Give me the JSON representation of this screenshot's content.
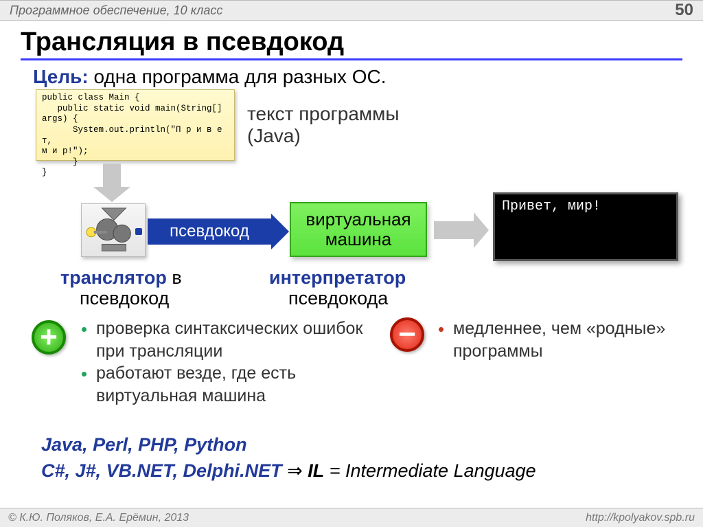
{
  "topbar": {
    "subject": "Программное обеспечение, 10 класс",
    "pagenum": "50"
  },
  "title": "Трансляция в псевдокод",
  "goal": {
    "label": "Цель:",
    "text": " одна программа для разных ОС."
  },
  "code": "public class Main {\n   public static void main(String[] args) {\n      System.out.println(\"П р и в е т,\nм и р!\");\n      }\n}",
  "progtext": {
    "l1": "текст программы",
    "l2": "(Java)"
  },
  "arrow_label": "псевдокод",
  "vm_box": "виртуальная\nмашина",
  "console_output": "Привет, мир!",
  "caption1": {
    "b": "транслятор",
    "rest": " в",
    "sub": "псевдокод"
  },
  "caption2": {
    "b": "интерпретатор",
    "sub": "псевдокода"
  },
  "pros": [
    "проверка синтаксических ошибок при трансляции",
    "работают везде, где есть виртуальная машина"
  ],
  "cons": [
    "медленнее, чем «родные» программы"
  ],
  "langs1": "Java, Perl, PHP, Python",
  "langs2": {
    "left": "C#, J#, VB.NET, Delphi.NET",
    "arrow": " ⇒ ",
    "il_bold": "IL",
    "il_rest": " = Intermediate Language"
  },
  "footer": {
    "author": "© К.Ю. Поляков, Е.А. Ерёмин, 2013",
    "url": "http://kpolyakov.spb.ru"
  }
}
